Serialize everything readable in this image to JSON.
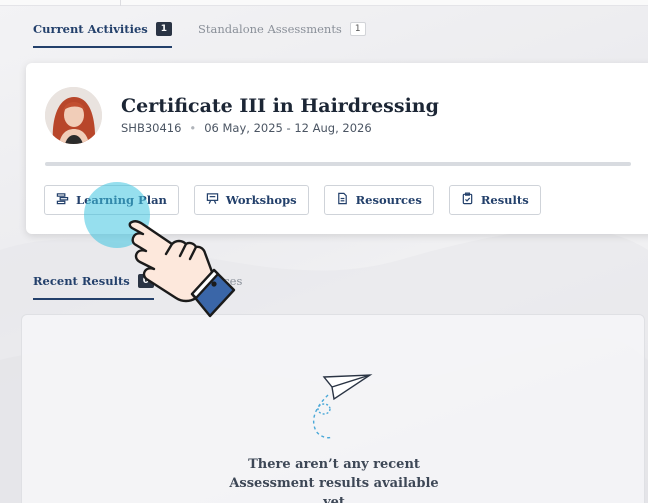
{
  "tabs": [
    {
      "label": "Current Activities",
      "count": "1",
      "active": true
    },
    {
      "label": "Standalone Assessments",
      "count": "1",
      "active": false
    }
  ],
  "course": {
    "title": "Certificate III in Hairdressing",
    "code": "SHB30416",
    "dates": "06 May, 2025 - 12 Aug, 2026",
    "progress_percent": 0
  },
  "actions": [
    {
      "label": "Learning Plan",
      "icon": "list-icon"
    },
    {
      "label": "Workshops",
      "icon": "presentation-icon"
    },
    {
      "label": "Resources",
      "icon": "document-icon"
    },
    {
      "label": "Results",
      "icon": "clipboard-check-icon"
    }
  ],
  "recent_tabs": [
    {
      "label": "Recent Results",
      "count": "0",
      "active": true
    },
    {
      "label": "Resources",
      "active": false
    }
  ],
  "empty_state": {
    "line1": "There aren’t any recent",
    "line2": "Assessment results available",
    "line3": "yet"
  },
  "colors": {
    "accent": "#23406b",
    "badge": "#2a3444",
    "click_highlight": "#40c4e0"
  }
}
